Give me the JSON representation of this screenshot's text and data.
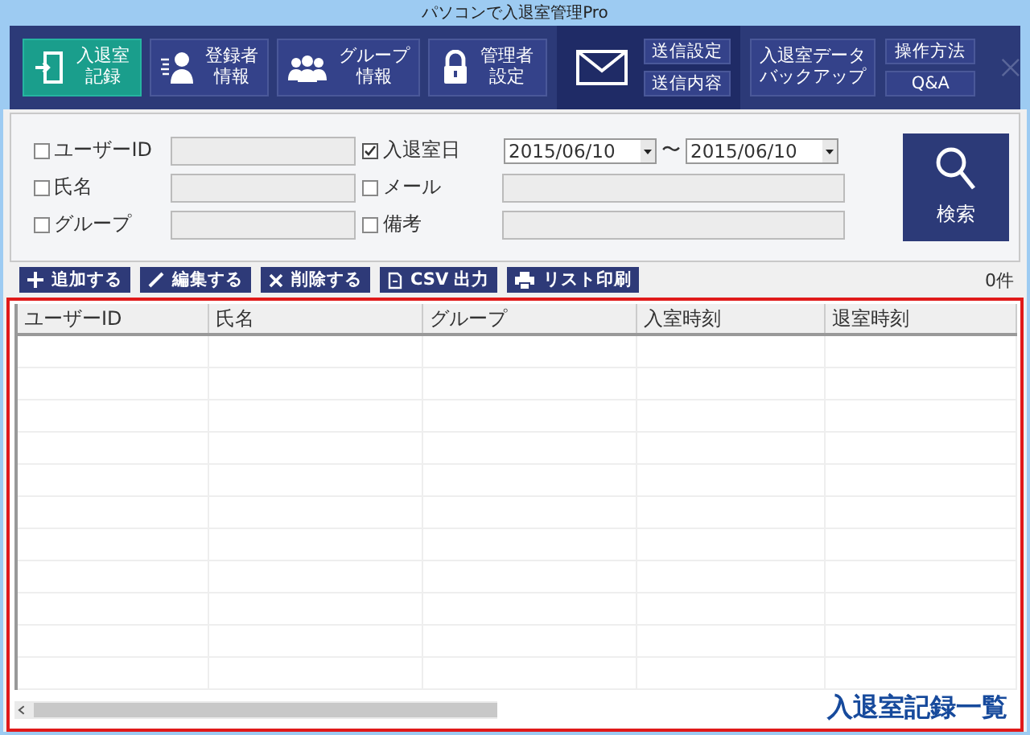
{
  "window": {
    "title": "パソコンで入退室管理Pro"
  },
  "toolbar": {
    "nav_buttons": [
      {
        "label": "入退室記録",
        "selected": true
      },
      {
        "label": "登録者情報",
        "selected": false
      },
      {
        "label": "グループ情報",
        "selected": false
      },
      {
        "label": "管理者設定",
        "selected": false
      }
    ],
    "mail_buttons": [
      "送信設定",
      "送信内容"
    ],
    "backup_button": "入退室データバックアップ",
    "help_buttons": [
      "操作方法",
      "Q&A"
    ]
  },
  "filters": [
    {
      "kind": "text",
      "label": "ユーザーID",
      "checked": false
    },
    {
      "kind": "date_range",
      "label": "入退室日",
      "checked": true,
      "from": "2015/06/10",
      "separator": "〜",
      "to": "2015/06/10"
    },
    {
      "kind": "text",
      "label": "氏名",
      "checked": false
    },
    {
      "kind": "text",
      "label": "メール",
      "checked": false
    },
    {
      "kind": "text",
      "label": "グループ",
      "checked": false
    },
    {
      "kind": "text",
      "label": "備考",
      "checked": false
    }
  ],
  "search_button": "検索",
  "actions": [
    {
      "label": "追加する"
    },
    {
      "label": "編集する"
    },
    {
      "label": "削除する"
    },
    {
      "label": "CSV 出力"
    },
    {
      "label": "リスト印刷"
    }
  ],
  "record_count": "0件",
  "table": {
    "columns": [
      "ユーザーID",
      "氏名",
      "グループ",
      "入室時刻",
      "退室時刻"
    ]
  },
  "caption": "入退室記録一覧"
}
